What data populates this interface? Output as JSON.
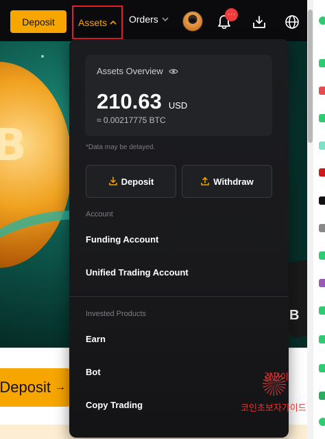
{
  "nav": {
    "deposit_label": "Deposit",
    "assets_label": "Assets",
    "orders_label": "Orders",
    "notification_badge": "···"
  },
  "icons": {
    "assets_caret": "chevron-up-icon",
    "orders_caret": "chevron-down-icon",
    "bell": "bell-icon",
    "download": "download-icon",
    "globe": "globe-icon",
    "eye": "eye-icon"
  },
  "dropdown": {
    "overview_title": "Assets Overview",
    "total_amount": "210.63",
    "total_currency": "USD",
    "btc_equivalent": "≈ 0.00217775 BTC",
    "delay_note": "*Data may be delayed.",
    "deposit_button": "Deposit",
    "withdraw_button": "Withdraw",
    "account_section": "Account",
    "funding_account": "Funding Account",
    "unified_trading_account": "Unified Trading Account",
    "invested_section": "Invested Products",
    "earn": "Earn",
    "bot": "Bot",
    "copy_trading": "Copy Trading"
  },
  "hero": {
    "deposit_big_label": "Deposit",
    "arrow": "→"
  },
  "watermark": {
    "line1": "감군이",
    "line2": "코인초보자가이드"
  },
  "colors": {
    "accent": "#f7a600",
    "highlight_border": "#e51e2b",
    "dropdown_bg": "#1b1c1f",
    "badge": "#ef3b3b"
  }
}
